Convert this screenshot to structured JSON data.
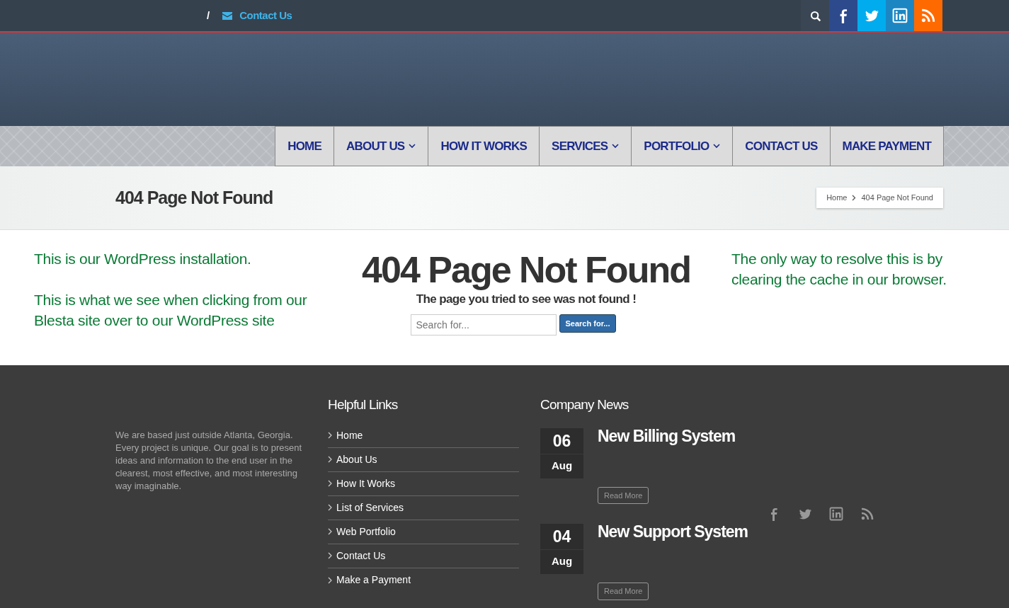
{
  "topbar": {
    "separator": "/",
    "contact_link": "Contact Us",
    "social": [
      {
        "kind": "search",
        "color": "#3a4654"
      },
      {
        "kind": "facebook",
        "color": "#2d4a8c"
      },
      {
        "kind": "twitter",
        "color": "#00aced"
      },
      {
        "kind": "linkedin",
        "color": "#1c86c3"
      },
      {
        "kind": "rss",
        "color": "#ff6a00"
      }
    ]
  },
  "nav": [
    {
      "label": "HOME",
      "has_dropdown": false
    },
    {
      "label": "ABOUT US",
      "has_dropdown": true
    },
    {
      "label": "HOW IT WORKS",
      "has_dropdown": false
    },
    {
      "label": "SERVICES",
      "has_dropdown": true
    },
    {
      "label": "PORTFOLIO",
      "has_dropdown": true
    },
    {
      "label": "CONTACT US",
      "has_dropdown": false
    },
    {
      "label": "MAKE PAYMENT",
      "has_dropdown": false
    }
  ],
  "title_bar": {
    "title": "404 Page Not Found",
    "breadcrumb": [
      "Home",
      "404 Page Not Found"
    ]
  },
  "notes_left": [
    "This is our WordPress installation.",
    "This is what we see when clicking from our Blesta site over to our WordPress site"
  ],
  "notes_right": "The only way to resolve this is by clearing the cache in our browser.",
  "error": {
    "heading": "404 Page Not Found",
    "message": "The page you tried to see was not found !",
    "search": {
      "placeholder": "Search for...",
      "button": "Search for..."
    }
  },
  "footer": {
    "about": "We are based just outside Atlanta, Georgia. Every project is unique. Our goal is to present ideas and information to the end user in the clearest, most effective, and most interesting way imaginable.",
    "links_title": "Helpful Links",
    "links": [
      "Home",
      "About Us",
      "How It Works",
      "List of Services",
      "Web Portfolio",
      "Contact Us",
      "Make a Payment"
    ],
    "news_title": "Company News",
    "news": [
      {
        "day": "06",
        "month": "Aug",
        "title": "New Billing System",
        "button": "Read More"
      },
      {
        "day": "04",
        "month": "Aug",
        "title": "New Support System",
        "button": "Read More"
      }
    ],
    "social": [
      {
        "kind": "facebook"
      },
      {
        "kind": "twitter"
      },
      {
        "kind": "linkedin"
      },
      {
        "kind": "rss"
      }
    ]
  }
}
